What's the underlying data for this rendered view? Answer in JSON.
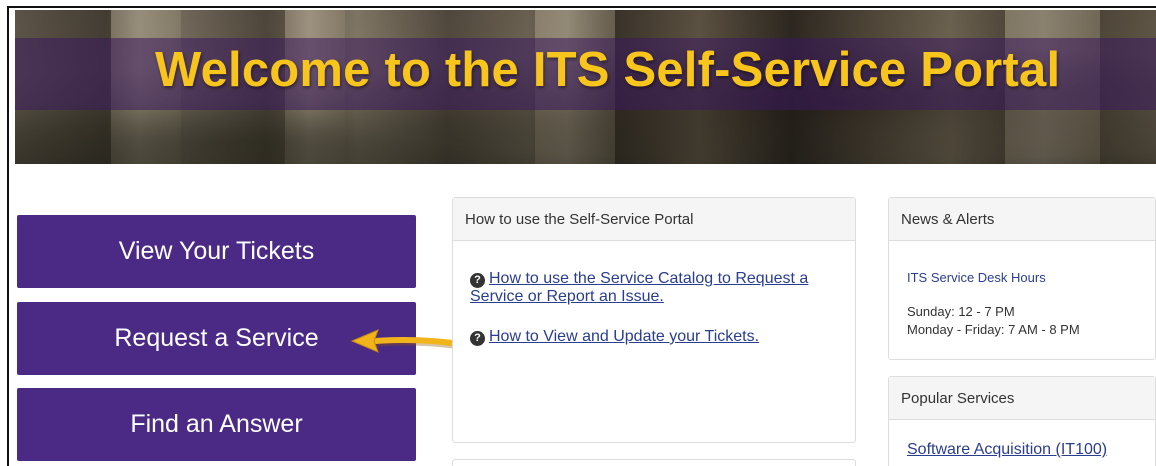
{
  "banner": {
    "title": "Welcome to the ITS Self-Service Portal"
  },
  "nav": {
    "view_tickets": "View Your Tickets",
    "request_service": "Request a Service",
    "find_answer": "Find an Answer"
  },
  "how_to_panel": {
    "heading": "How to use the Self-Service Portal",
    "links": [
      {
        "icon": "question-circle-icon",
        "text": "How to use the Service Catalog to Request a Service or Report an Issue."
      },
      {
        "icon": "question-circle-icon",
        "text": "How to View and Update your Tickets."
      }
    ]
  },
  "news_panel": {
    "heading": "News & Alerts",
    "item_title": "ITS Service Desk Hours",
    "lines": [
      "Sunday: 12 - 7 PM",
      "Monday - Friday: 7 AM - 8 PM"
    ]
  },
  "popular_panel": {
    "heading": "Popular Services",
    "items": [
      "Software Acquisition (IT100)"
    ]
  },
  "colors": {
    "purple": "#4b2a85",
    "gold": "#f8c51c",
    "arrow": "#f2b41b",
    "link": "#2a3d8f"
  }
}
